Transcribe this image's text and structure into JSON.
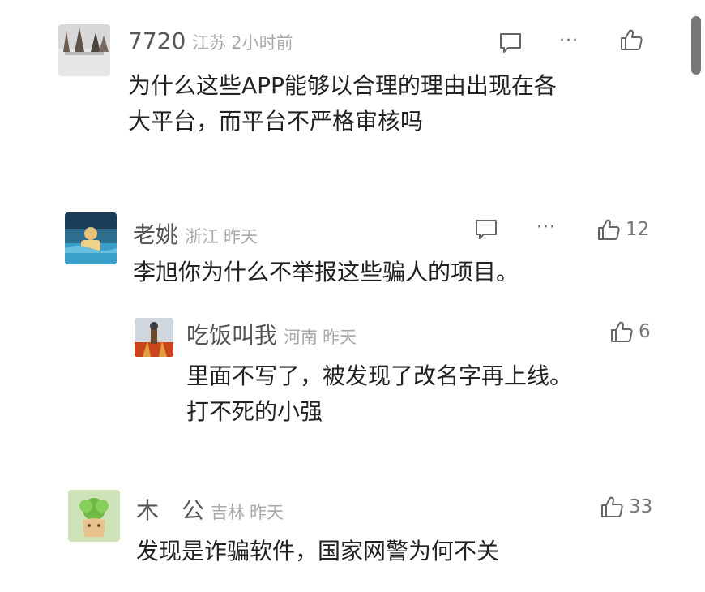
{
  "comments": [
    {
      "username": "7720",
      "region": "江苏",
      "time": "2小时前",
      "text": "为什么这些APP能够以合理的理由出现在各\n大平台，而平台不严格审核吗",
      "likes": ""
    },
    {
      "username": "老姚",
      "region": "浙江",
      "time": "昨天",
      "text": "李旭你为什么不举报这些骗人的项目。",
      "likes": "12"
    },
    {
      "username": "吃饭叫我",
      "region": "河南",
      "time": "昨天",
      "text": "里面不写了，被发现了改名字再上线。\n打不死的小强",
      "likes": "6"
    },
    {
      "username": "木　公",
      "region": "吉林",
      "time": "昨天",
      "text": "发现是诈骗软件，国家网警为何不关",
      "likes": "33"
    }
  ],
  "more_label": "···",
  "icons": {
    "reply": "comment-bubble-icon",
    "more": "more-dots-icon",
    "like": "thumbs-up-icon"
  }
}
